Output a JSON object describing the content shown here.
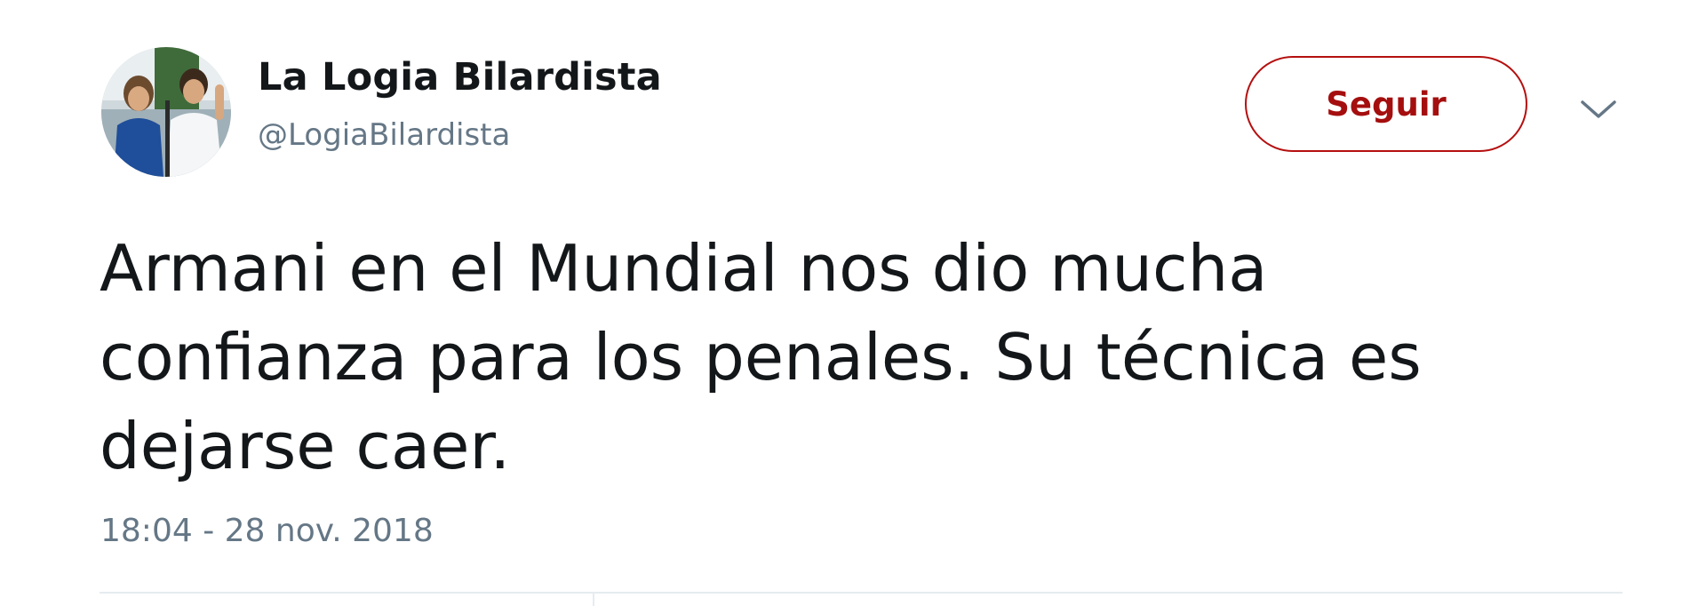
{
  "tweet": {
    "author": {
      "display_name": "La Logia Bilardista",
      "handle": "@LogiaBilardista",
      "avatar_icon": "profile-photo"
    },
    "follow_label": "Seguir",
    "menu_icon": "chevron-down-icon",
    "text": "Armani en el Mundial nos dio mucha\nconfianza para los penales. Su técnica es\ndejarse caer.",
    "timestamp": "18:04 - 28 nov. 2018"
  },
  "colors": {
    "follow_accent": "#b50f0f",
    "text_primary": "#14171a",
    "text_secondary": "#657786",
    "divider": "#e6ecf0"
  }
}
